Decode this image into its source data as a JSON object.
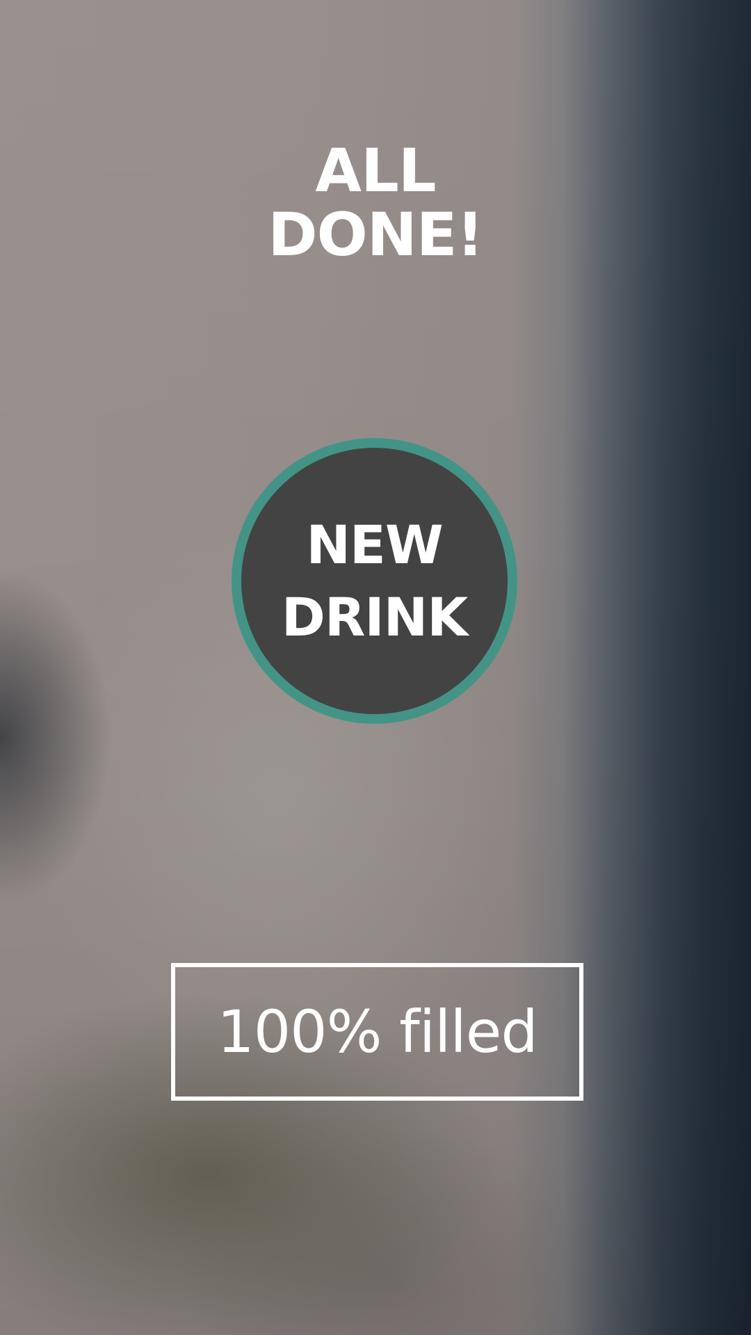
{
  "screen": {
    "title_line1": "ALL",
    "title_line2": "DONE!"
  },
  "new_drink_button": {
    "label_line1": "NEW",
    "label_line2": "DRINK"
  },
  "fill_status": {
    "text": "100% filled",
    "percent": 100
  },
  "colors": {
    "button_fill": "#434343",
    "button_ring": "#439486",
    "text": "#ffffff"
  }
}
